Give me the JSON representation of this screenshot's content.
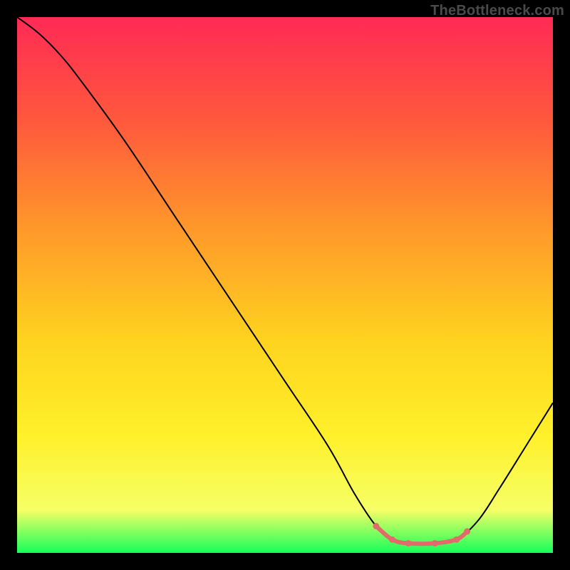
{
  "attribution": "TheBottleneck.com",
  "chart_data": {
    "type": "line",
    "title": "",
    "xlabel": "",
    "ylabel": "",
    "xlim": [
      0,
      100
    ],
    "ylim": [
      0,
      100
    ],
    "gradient_stops": [
      {
        "offset": 0,
        "color": "#ff2a55"
      },
      {
        "offset": 20,
        "color": "#ff5a3c"
      },
      {
        "offset": 40,
        "color": "#ff9a2a"
      },
      {
        "offset": 60,
        "color": "#ffd21f"
      },
      {
        "offset": 78,
        "color": "#fff02a"
      },
      {
        "offset": 92,
        "color": "#f6ff66"
      },
      {
        "offset": 100,
        "color": "#14ff5a"
      }
    ],
    "series": [
      {
        "name": "bottleneck-curve",
        "color": "#000000",
        "width": 2,
        "points": [
          {
            "x": 0,
            "y": 100
          },
          {
            "x": 4,
            "y": 97
          },
          {
            "x": 8,
            "y": 93
          },
          {
            "x": 12,
            "y": 88
          },
          {
            "x": 20,
            "y": 77
          },
          {
            "x": 30,
            "y": 62
          },
          {
            "x": 40,
            "y": 47
          },
          {
            "x": 50,
            "y": 32
          },
          {
            "x": 58,
            "y": 20
          },
          {
            "x": 63,
            "y": 11
          },
          {
            "x": 67,
            "y": 5
          },
          {
            "x": 70,
            "y": 2.5
          },
          {
            "x": 73,
            "y": 1.8
          },
          {
            "x": 78,
            "y": 1.8
          },
          {
            "x": 82,
            "y": 2.5
          },
          {
            "x": 86,
            "y": 6
          },
          {
            "x": 90,
            "y": 12
          },
          {
            "x": 95,
            "y": 20
          },
          {
            "x": 100,
            "y": 28
          }
        ]
      },
      {
        "name": "valley-highlight",
        "color": "#e26a6a",
        "width": 6,
        "points": [
          {
            "x": 67,
            "y": 5
          },
          {
            "x": 70,
            "y": 2.5
          },
          {
            "x": 73,
            "y": 1.8
          },
          {
            "x": 78,
            "y": 1.8
          },
          {
            "x": 82,
            "y": 2.5
          },
          {
            "x": 84,
            "y": 4
          }
        ]
      }
    ]
  }
}
